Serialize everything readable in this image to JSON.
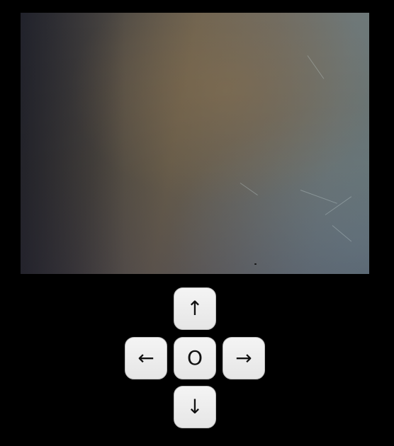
{
  "camera": {
    "feed_icon": "camera-feed"
  },
  "controls": {
    "up_label": "↑",
    "left_label": "←",
    "stop_label": "O",
    "right_label": "→",
    "down_label": "↓"
  }
}
